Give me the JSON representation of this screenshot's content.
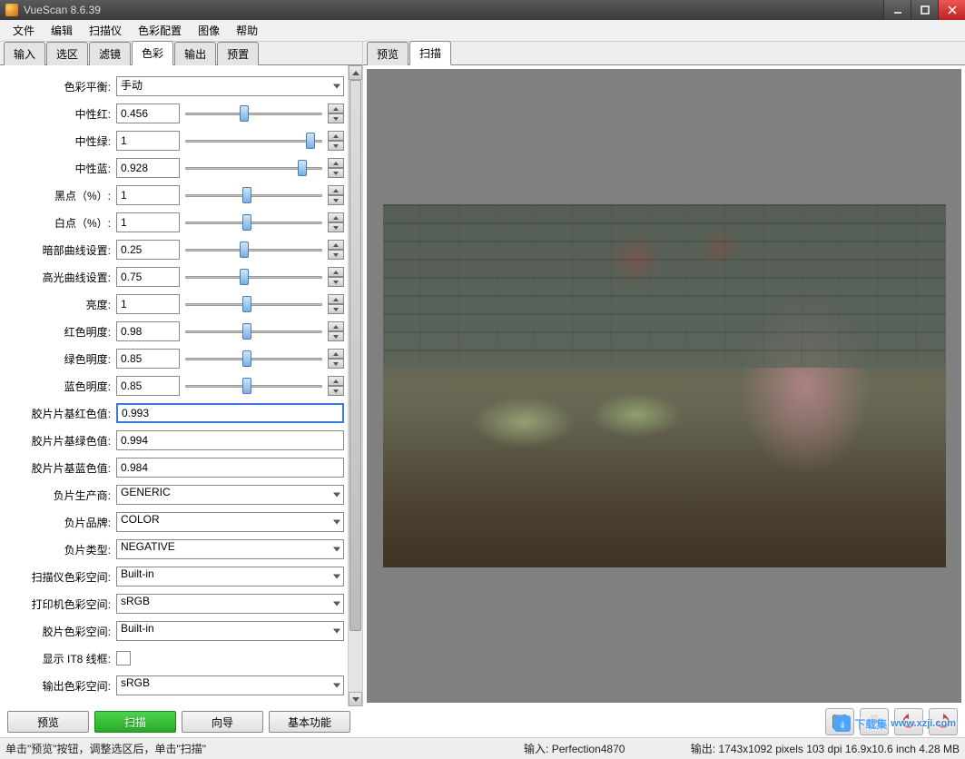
{
  "window": {
    "title": "VueScan 8.6.39"
  },
  "menu": [
    "文件",
    "编辑",
    "扫描仪",
    "色彩配置",
    "图像",
    "帮助"
  ],
  "left_tabs": [
    "输入",
    "选区",
    "滤镜",
    "色彩",
    "输出",
    "预置"
  ],
  "left_active": 3,
  "right_tabs": [
    "预览",
    "扫描"
  ],
  "right_active": 1,
  "settings": {
    "color_balance": {
      "label": "色彩平衡:",
      "value": "手动"
    },
    "neutral_red": {
      "label": "中性红:",
      "value": "0.456",
      "pos": 40
    },
    "neutral_green": {
      "label": "中性绿:",
      "value": "1",
      "pos": 88
    },
    "neutral_blue": {
      "label": "中性蓝:",
      "value": "0.928",
      "pos": 82
    },
    "black_pt": {
      "label": "黑点（%）:",
      "value": "1",
      "pos": 42
    },
    "white_pt": {
      "label": "白点（%）:",
      "value": "1",
      "pos": 42
    },
    "dark_curve": {
      "label": "暗部曲线设置:",
      "value": "0.25",
      "pos": 40
    },
    "high_curve": {
      "label": "高光曲线设置:",
      "value": "0.75",
      "pos": 40
    },
    "brightness": {
      "label": "亮度:",
      "value": "1",
      "pos": 42
    },
    "red_bright": {
      "label": "红色明度:",
      "value": "0.98",
      "pos": 42
    },
    "green_bright": {
      "label": "绿色明度:",
      "value": "0.85",
      "pos": 42
    },
    "blue_bright": {
      "label": "蓝色明度:",
      "value": "0.85",
      "pos": 42
    },
    "film_base_r": {
      "label": "胶片片基红色值:",
      "value": "0.993",
      "highlight": true
    },
    "film_base_g": {
      "label": "胶片片基绿色值:",
      "value": "0.994"
    },
    "film_base_b": {
      "label": "胶片片基蓝色值:",
      "value": "0.984"
    },
    "neg_vendor": {
      "label": "负片生产商:",
      "value": "GENERIC"
    },
    "neg_brand": {
      "label": "负片品牌:",
      "value": "COLOR"
    },
    "neg_type": {
      "label": "负片类型:",
      "value": "NEGATIVE"
    },
    "scanner_space": {
      "label": "扫描仪色彩空间:",
      "value": "Built-in"
    },
    "printer_space": {
      "label": "打印机色彩空间:",
      "value": "sRGB"
    },
    "film_space": {
      "label": "胶片色彩空间:",
      "value": "Built-in"
    },
    "show_it8": {
      "label": "显示 IT8 线框:"
    },
    "output_space": {
      "label": "输出色彩空间:",
      "value": "sRGB"
    }
  },
  "buttons": {
    "preview": "预览",
    "scan": "扫描",
    "guide": "向导",
    "basic": "基本功能"
  },
  "status": {
    "hint": "单击\"预览\"按钮，调整选区后，单击\"扫描\"",
    "input": "输入: Perfection4870",
    "output": "输出: 1743x1092 pixels 103 dpi 16.9x10.6 inch 4.28 MB"
  },
  "watermark": {
    "text": "下载集",
    "url": "www.xzji.com"
  }
}
